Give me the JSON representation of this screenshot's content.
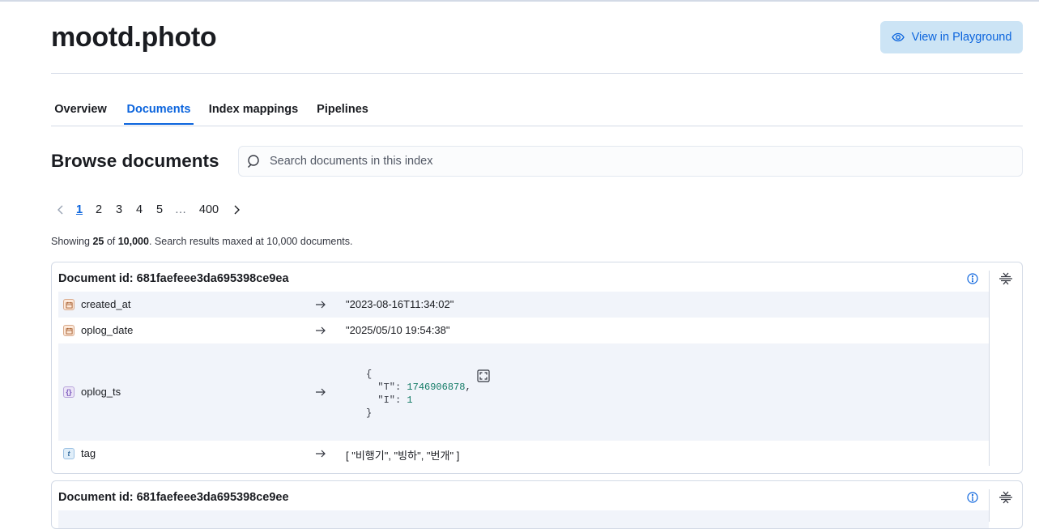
{
  "header": {
    "index_name": "mootd.photo",
    "playground_button": "View in Playground"
  },
  "tabs": [
    {
      "label": "Overview",
      "active": false
    },
    {
      "label": "Documents",
      "active": true
    },
    {
      "label": "Index mappings",
      "active": false
    },
    {
      "label": "Pipelines",
      "active": false
    }
  ],
  "browse": {
    "title": "Browse documents",
    "search_placeholder": "Search documents in this index"
  },
  "pagination": {
    "pages": [
      "1",
      "2",
      "3",
      "4",
      "5"
    ],
    "ellipsis": "…",
    "last": "400",
    "current": "1"
  },
  "results": {
    "prefix": "Showing ",
    "shown": "25",
    "of": " of ",
    "total": "10,000",
    "suffix": ". Search results maxed at 10,000 documents."
  },
  "documents": [
    {
      "title": "Document id: 681faefeee3da695398ce9ea",
      "fields": [
        {
          "name": "created_at",
          "type": "date",
          "value": "\"2023-08-16T11:34:02\""
        },
        {
          "name": "oplog_date",
          "type": "date",
          "value": "\"2025/05/10 19:54:38\""
        },
        {
          "name": "oplog_ts",
          "type": "object",
          "json": {
            "open": "{",
            "k1": "\"T\"",
            "v1": "1746906878",
            "k2": "\"I\"",
            "v2": "1",
            "close": "}"
          }
        },
        {
          "name": "tag",
          "type": "text",
          "value": "[ \"비행기\", \"빙하\", \"번개\" ]"
        }
      ]
    },
    {
      "title": "Document id: 681faefeee3da695398ce9ee"
    }
  ],
  "colors": {
    "accent": "#0b64dd",
    "button_bg": "#cce4f5",
    "row_shade": "#f1f4fa",
    "border": "#d3dae6"
  }
}
